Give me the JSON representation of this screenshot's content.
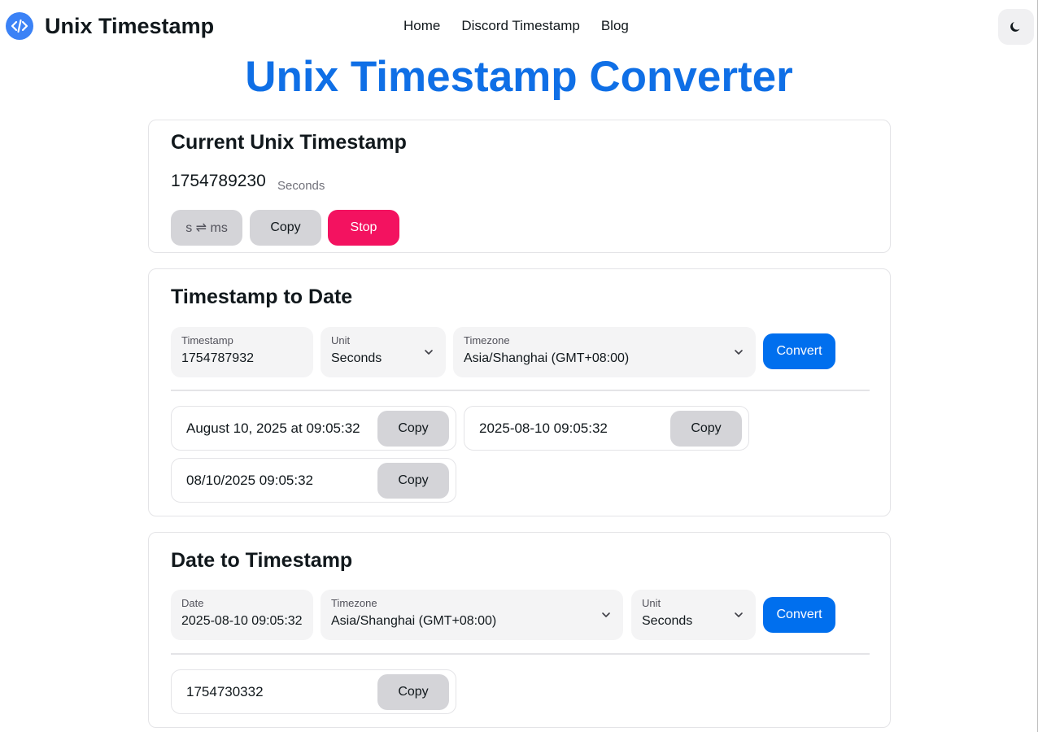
{
  "header": {
    "brand": "Unix Timestamp",
    "nav": [
      "Home",
      "Discord Timestamp",
      "Blog"
    ]
  },
  "page_title": "Unix Timestamp Converter",
  "current": {
    "title": "Current Unix Timestamp",
    "value": "1754789230",
    "unit": "Seconds",
    "toggle_label": "s ⇌ ms",
    "copy_label": "Copy",
    "stop_label": "Stop"
  },
  "ts_to_date": {
    "title": "Timestamp to Date",
    "timestamp_label": "Timestamp",
    "timestamp_value": "1754787932",
    "unit_label": "Unit",
    "unit_value": "Seconds",
    "timezone_label": "Timezone",
    "timezone_value": "Asia/Shanghai (GMT+08:00)",
    "convert_label": "Convert",
    "results": [
      {
        "text": "August 10, 2025 at 09:05:32",
        "copy": "Copy"
      },
      {
        "text": "2025-08-10 09:05:32",
        "copy": "Copy"
      },
      {
        "text": "08/10/2025 09:05:32",
        "copy": "Copy"
      }
    ]
  },
  "date_to_ts": {
    "title": "Date to Timestamp",
    "date_label": "Date",
    "date_value": "2025-08-10 09:05:32",
    "timezone_label": "Timezone",
    "timezone_value": "Asia/Shanghai (GMT+08:00)",
    "unit_label": "Unit",
    "unit_value": "Seconds",
    "convert_label": "Convert",
    "result": {
      "text": "1754730332",
      "copy": "Copy"
    }
  },
  "colors": {
    "accent": "#006fee",
    "title": "#0f6fe6",
    "stop": "#f31260"
  }
}
